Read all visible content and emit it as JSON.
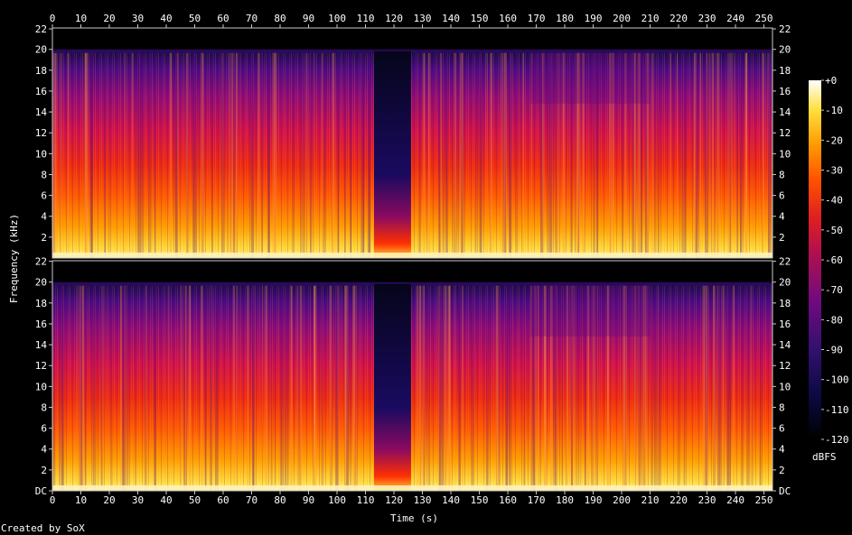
{
  "chart_data": {
    "type": "heatmap",
    "kind": "spectrogram",
    "channels": 2,
    "xlabel": "Time (s)",
    "ylabel": "Frequency (kHz)",
    "x_ticks": [
      0,
      10,
      20,
      30,
      40,
      50,
      60,
      70,
      80,
      90,
      100,
      110,
      120,
      130,
      140,
      150,
      160,
      170,
      180,
      190,
      200,
      210,
      220,
      230,
      240,
      250
    ],
    "xlim": [
      0,
      253
    ],
    "top_y_ticks": [
      "22",
      "20",
      "18",
      "16",
      "14",
      "12",
      "10",
      "8",
      "6",
      "4",
      "2"
    ],
    "bottom_y_ticks": [
      "22",
      "20",
      "18",
      "16",
      "14",
      "12",
      "10",
      "8",
      "6",
      "4",
      "2",
      "DC"
    ],
    "y_tick_values": [
      22,
      20,
      18,
      16,
      14,
      12,
      10,
      8,
      6,
      4,
      2
    ],
    "ylim_khz": [
      0,
      22.05
    ],
    "lowpass_cutoff_khz": 20,
    "quiet_section_s": [
      113,
      126
    ],
    "colorbar": {
      "unit": "dBFS",
      "ticks": [
        "+0",
        "-10",
        "-20",
        "-30",
        "-40",
        "-50",
        "-60",
        "-70",
        "-80",
        "-90",
        "-100",
        "-110",
        "-120"
      ],
      "range_db": [
        -120,
        0
      ]
    },
    "credit": "Created by SoX"
  }
}
